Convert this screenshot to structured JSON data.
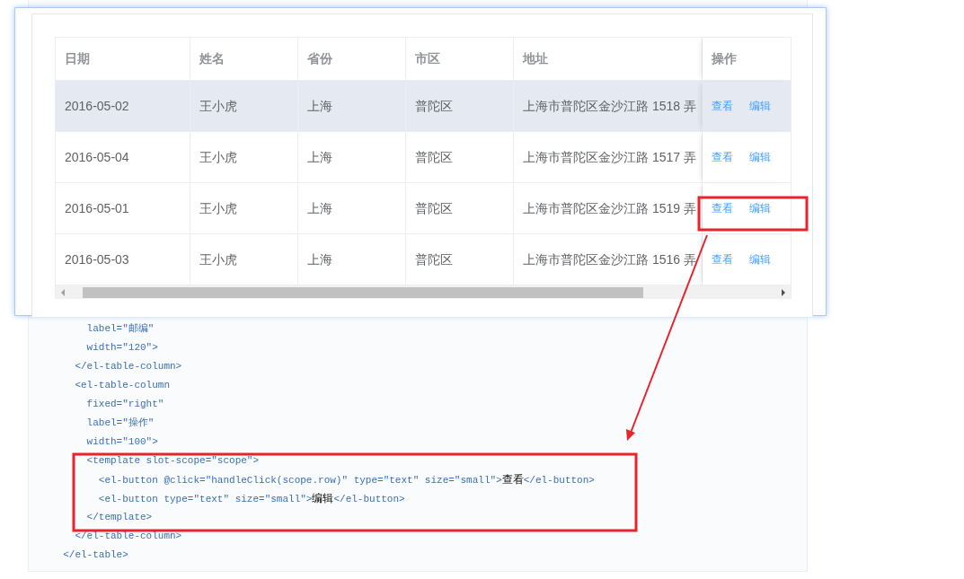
{
  "table": {
    "columns": [
      "日期",
      "姓名",
      "省份",
      "市区",
      "地址",
      "操作"
    ],
    "rows": [
      {
        "cells": [
          "2016-05-02",
          "王小虎",
          "上海",
          "普陀区",
          "上海市普陀区金沙江路 1518 弄"
        ],
        "actions": [
          "查看",
          "编辑"
        ],
        "hovered": true
      },
      {
        "cells": [
          "2016-05-04",
          "王小虎",
          "上海",
          "普陀区",
          "上海市普陀区金沙江路 1517 弄"
        ],
        "actions": [
          "查看",
          "编辑"
        ],
        "hovered": false
      },
      {
        "cells": [
          "2016-05-01",
          "王小虎",
          "上海",
          "普陀区",
          "上海市普陀区金沙江路 1519 弄"
        ],
        "actions": [
          "查看",
          "编辑"
        ],
        "hovered": false
      },
      {
        "cells": [
          "2016-05-03",
          "王小虎",
          "上海",
          "普陀区",
          "上海市普陀区金沙江路 1516 弄"
        ],
        "actions": [
          "查看",
          "编辑"
        ],
        "hovered": false
      }
    ]
  },
  "code_lines": [
    [
      {
        "kind": "code",
        "text": "      label=\"邮编\""
      }
    ],
    [
      {
        "kind": "code",
        "text": "      width=\"120\">"
      }
    ],
    [
      {
        "kind": "code",
        "text": "    </el-table-column>"
      }
    ],
    [
      {
        "kind": "code",
        "text": "    <el-table-column"
      }
    ],
    [
      {
        "kind": "code",
        "text": "      fixed=\"right\""
      }
    ],
    [
      {
        "kind": "code",
        "text": "      label=\"操作\""
      }
    ],
    [
      {
        "kind": "code",
        "text": "      width=\"100\">"
      }
    ],
    [
      {
        "kind": "code",
        "text": "      <template slot-scope=\"scope\">"
      }
    ],
    [
      {
        "kind": "code",
        "text": "        <el-button @click=\"handleClick(scope.row)\" type=\"text\" size=\"small\">"
      },
      {
        "kind": "text",
        "text": "查看"
      },
      {
        "kind": "code",
        "text": "</el-button>"
      }
    ],
    [
      {
        "kind": "code",
        "text": "        <el-button type=\"text\" size=\"small\">"
      },
      {
        "kind": "text",
        "text": "编辑"
      },
      {
        "kind": "code",
        "text": "</el-button>"
      }
    ],
    [
      {
        "kind": "code",
        "text": "      </template>"
      }
    ],
    [
      {
        "kind": "code",
        "text": "    </el-table-column>"
      }
    ],
    [
      {
        "kind": "code",
        "text": "  </el-table>"
      }
    ]
  ]
}
